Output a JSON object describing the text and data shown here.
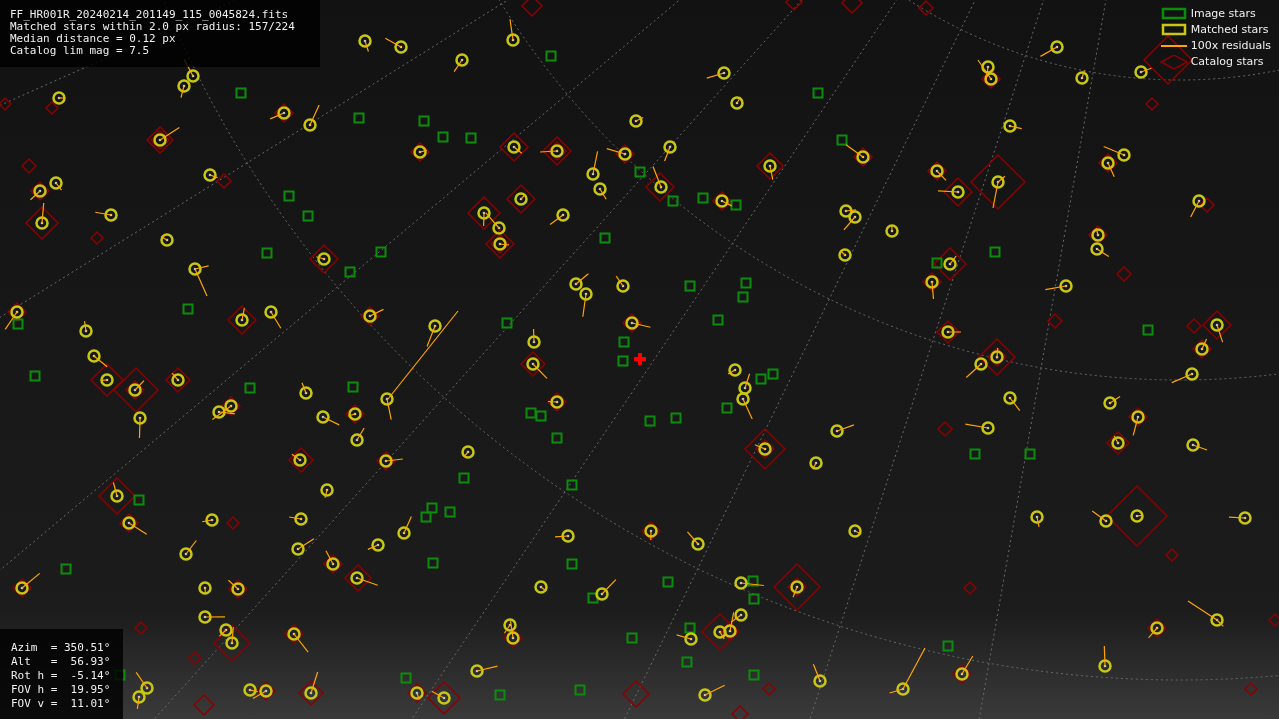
{
  "info": {
    "lines": [
      "FF_HR001R_20240214_201149_115_0045824.fits",
      "Matched stars within 2.0 px radius: 157/224",
      "Median distance = 0.12 px",
      "Catalog lim mag = 7.5"
    ]
  },
  "legend": {
    "items": [
      {
        "kind": "image",
        "label": "Image stars",
        "color": "#0c8c0c"
      },
      {
        "kind": "matched",
        "label": "Matched stars",
        "color": "#c8c814"
      },
      {
        "kind": "residual",
        "label": "100x residuals",
        "color": "#ffa500"
      },
      {
        "kind": "catalog",
        "label": "Catalog stars",
        "color": "#8b0000"
      }
    ]
  },
  "pointing": {
    "lines": [
      "Azim  = 350.51°",
      "Alt   =  56.93°",
      "Rot h =  -5.14°",
      "FOV h =  19.95°",
      "FOV v =  11.01°"
    ]
  }
}
